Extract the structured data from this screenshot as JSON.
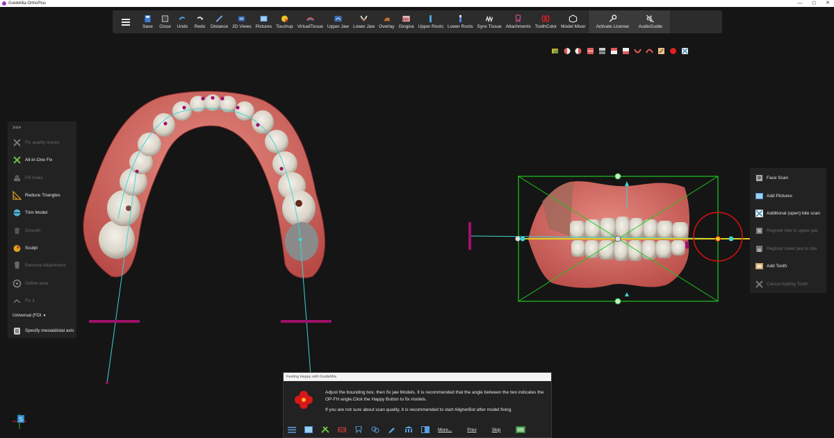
{
  "app": {
    "title": "GuideMia OrthoPlus"
  },
  "toolbar": {
    "buttons": [
      {
        "label": "Save",
        "icon": "save-icon"
      },
      {
        "label": "Close",
        "icon": "close-model-icon"
      },
      {
        "label": "Undo",
        "icon": "undo-icon"
      },
      {
        "label": "Redo",
        "icon": "redo-icon"
      },
      {
        "label": "Distance",
        "icon": "distance-icon"
      },
      {
        "label": "2D Views",
        "icon": "2d-views-icon"
      },
      {
        "label": "Pictures",
        "icon": "pictures-icon"
      },
      {
        "label": "Touchup",
        "icon": "touchup-icon"
      },
      {
        "label": "VirtualTissue",
        "icon": "virtual-tissue-icon"
      },
      {
        "label": "Upper Jaw",
        "icon": "upper-jaw-icon"
      },
      {
        "label": "Lower Jaw",
        "icon": "lower-jaw-icon"
      },
      {
        "label": "Overlay",
        "icon": "overlay-icon"
      },
      {
        "label": "Gingiva",
        "icon": "gingiva-icon"
      },
      {
        "label": "Upper Roots",
        "icon": "upper-roots-icon"
      },
      {
        "label": "Lower Roots",
        "icon": "lower-roots-icon"
      },
      {
        "label": "Sync Tissue",
        "icon": "sync-tissue-icon"
      },
      {
        "label": "Attachments",
        "icon": "attachments-icon"
      },
      {
        "label": "ToothColor",
        "icon": "tooth-color-icon"
      },
      {
        "label": "Model Mixer",
        "icon": "model-mixer-icon"
      }
    ],
    "right_buttons": [
      {
        "label": "Activate License",
        "icon": "key-icon"
      },
      {
        "label": "AudioGuide",
        "icon": "audio-mute-icon"
      }
    ]
  },
  "left_panel": {
    "toggle": ">>>",
    "items": [
      {
        "label": "Fix quality issues",
        "enabled": false,
        "icon": "fix-quality-icon"
      },
      {
        "label": "All-in-One Fix",
        "enabled": true,
        "icon": "all-in-one-fix-icon"
      },
      {
        "label": "Fill holes",
        "enabled": false,
        "icon": "fill-holes-icon"
      },
      {
        "label": "Reduce Triangles",
        "enabled": true,
        "icon": "reduce-triangles-icon"
      },
      {
        "label": "Trim Model",
        "enabled": true,
        "icon": "trim-model-icon"
      },
      {
        "label": "Smooth",
        "enabled": false,
        "icon": "smooth-icon"
      },
      {
        "label": "Sculpt",
        "enabled": true,
        "icon": "sculpt-icon"
      },
      {
        "label": "Remove Attachment",
        "enabled": false,
        "icon": "remove-attachment-icon"
      },
      {
        "label": "Define area",
        "enabled": false,
        "icon": "define-area-icon"
      },
      {
        "label": "Fix it",
        "enabled": false,
        "icon": "fix-it-icon"
      }
    ],
    "numbering_select": "Universal (FDI",
    "last_item": {
      "label": "Specify mesialdistal axis",
      "enabled": true,
      "icon": "mesiodistal-axis-icon"
    }
  },
  "right_panel": {
    "items": [
      {
        "label": "Face Scan",
        "enabled": true,
        "icon": "face-scan-icon"
      },
      {
        "label": "Add Pictures",
        "enabled": true,
        "icon": "add-pictures-icon"
      },
      {
        "label": "Additional (open) bite scan",
        "enabled": true,
        "icon": "bite-scan-icon"
      },
      {
        "label": "Register bite to upper jaw",
        "enabled": false,
        "icon": "register-upper-icon"
      },
      {
        "label": "Register lower jaw to bite",
        "enabled": false,
        "icon": "register-lower-icon"
      },
      {
        "label": "Add Tooth",
        "enabled": true,
        "icon": "add-tooth-icon"
      },
      {
        "label": "Cancel Adding Tooth",
        "enabled": false,
        "icon": "cancel-add-tooth-icon"
      }
    ]
  },
  "dialog": {
    "title": "Feeling Happy with GuideMia",
    "message_1": "Adjust the bounding box, then fix jaw Models. It is recommended that the angle between the two indicates the OP-FH angle.Click the Happy Button to fix models.",
    "message_2": "If you are not sure about scan quality, it is recommended to start AlignerBot after model fixing.",
    "footer_links": {
      "more": "More...",
      "prev": "Prev",
      "skip": "Skip"
    }
  },
  "colors": {
    "background": "#151515",
    "accent_cyan": "#3fd4d4",
    "magenta": "#a0106a",
    "bbox_green": "#1fc71f",
    "gingiva": "#d96a62"
  }
}
